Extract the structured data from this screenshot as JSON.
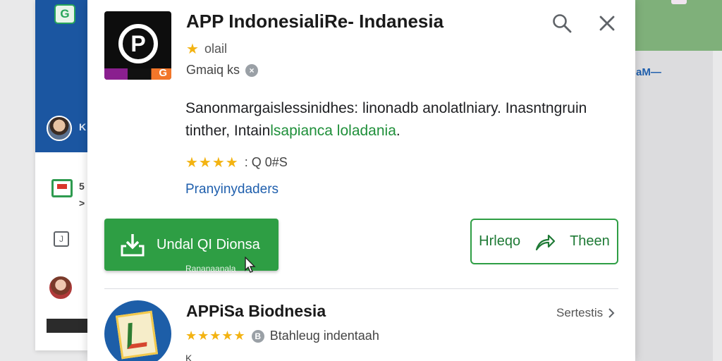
{
  "background": {
    "logo_letter": "G",
    "sidebar_letters": [
      "K",
      "5",
      ">"
    ],
    "small_square_label": "J",
    "right_text": "aM—"
  },
  "app": {
    "title": "APP IndonesialiRe- Indanesia",
    "rating_label": "olail",
    "meta_text": "Gmaiq ks",
    "meta_badge": "×",
    "description_line1": "Sanonmargaislessinidhes: linonadb anolatlniary. Inasntngruin",
    "description_line2_prefix": "tinther, Intain",
    "description_line2_highlight": "lsapianca loladania",
    "description_line2_suffix": ".",
    "stars": "★★★★",
    "rating_count": ": Q 0#S",
    "publisher_link": "Pranyinydaders"
  },
  "actions": {
    "install_label": "Undal QI Dionsa",
    "under_install_label": "Rananaanala",
    "share_label": "Hrleqo",
    "share_suffix": "Theen"
  },
  "related": {
    "title": "APPiSa Biodnesia",
    "stars": "★★★★★",
    "badge": "B",
    "subtitle": "Btahleug indentaah",
    "extra": "K",
    "see_all_label": "Sertestis"
  },
  "colors": {
    "brand_green": "#2e9e44",
    "link_blue": "#1f5fad",
    "star_yellow": "#f3b312"
  },
  "icons": [
    "search-icon",
    "close-icon",
    "download-icon",
    "share-icon",
    "chevron-right-icon",
    "star-icon",
    "cursor-icon"
  ]
}
